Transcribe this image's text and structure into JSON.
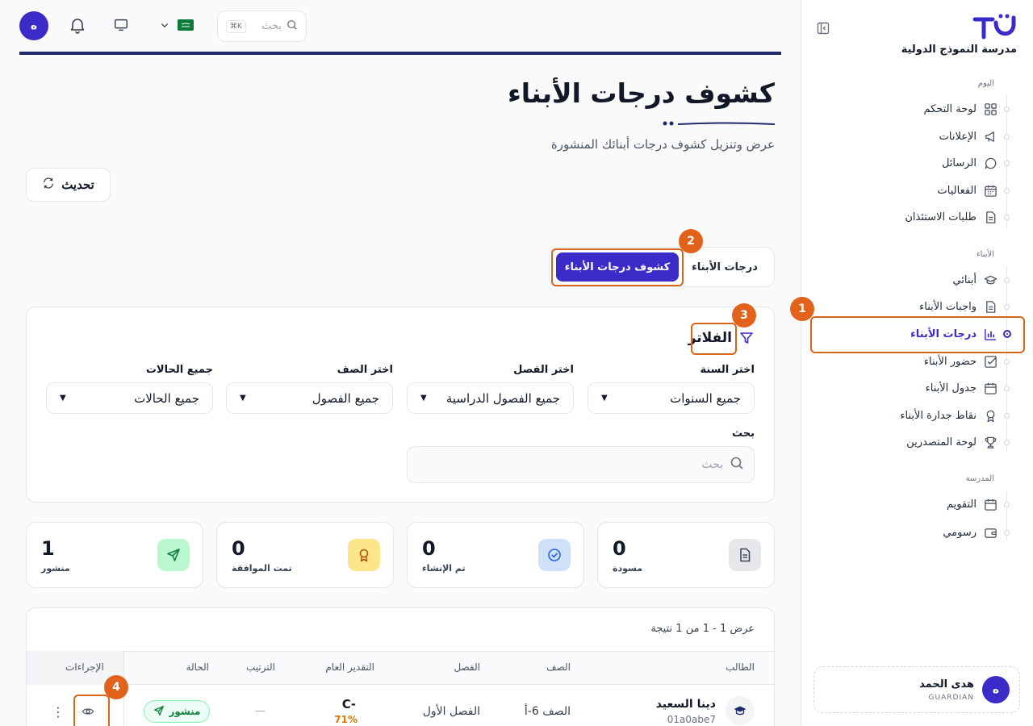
{
  "sidebar": {
    "school_name": "مدرسة النموذج الدولية",
    "sections": {
      "today": "اليوم",
      "children": "الأبناء",
      "school": "المدرسة"
    },
    "items": {
      "dashboard": "لوحة التحكم",
      "announcements": "الإعلانات",
      "messages": "الرسائل",
      "events": "الفعاليات",
      "permissions": "طلبات الاستئذان",
      "my_children": "أبنائي",
      "homework": "واجبات الأبناء",
      "grades": "درجات الأبناء",
      "attendance": "حضور الأبناء",
      "schedule": "جدول الأبناء",
      "merit": "نقاط جدارة الأبناء",
      "leaderboard": "لوحة المتصدرين",
      "calendar": "التقويم",
      "fees": "رسومي"
    },
    "user": {
      "initial": "ه",
      "name": "هدى الحمد",
      "role": "GUARDIAN"
    }
  },
  "topbar": {
    "avatar_initial": "ه",
    "search_placeholder": "بحث",
    "shortcut": "K⌘"
  },
  "header": {
    "title": "كشوف درجات الأبناء",
    "subtitle": "عرض وتنزيل كشوف درجات أبنائك المنشورة",
    "refresh_label": "تحديث"
  },
  "tabs": {
    "grades": "درجات الأبناء",
    "report_cards": "كشوف درجات الأبناء"
  },
  "filters": {
    "title": "الفلاتر",
    "year_label": "اختر السنة",
    "year_value": "جميع السنوات",
    "term_label": "اختر الفصل",
    "term_value": "جميع الفصول الدراسية",
    "class_label": "اختر الصف",
    "class_value": "جميع الفصول",
    "status_label": "جميع الحالات",
    "status_value": "جميع الحالات",
    "search_label": "بحث",
    "search_placeholder": "بحث"
  },
  "stats": {
    "draft": {
      "value": "0",
      "label": "مسودة"
    },
    "created": {
      "value": "0",
      "label": "تم الإنشاء"
    },
    "approved": {
      "value": "0",
      "label": "تمت الموافقة"
    },
    "published": {
      "value": "1",
      "label": "منشور"
    }
  },
  "table": {
    "result_count": "عرض 1 - 1 من 1 نتيجة",
    "headers": {
      "student": "الطالب",
      "class": "الصف",
      "term": "الفصل",
      "grade": "التقدير العام",
      "rank": "الترتيب",
      "status": "الحالة",
      "actions": "الإجراءات"
    },
    "rows": [
      {
        "name": "دينا السعيد",
        "id": "01a0abe7",
        "class": "الصف 6-أ",
        "term": "الفصل الأول",
        "grade": "-C",
        "percent": "71%",
        "rank": "—",
        "status": "منشور"
      }
    ]
  },
  "annotations": [
    "1",
    "2",
    "3",
    "4"
  ],
  "colors": {
    "brand": "#3b2cc9",
    "annotation": "#e2621c",
    "navy": "#1e2a6e"
  }
}
